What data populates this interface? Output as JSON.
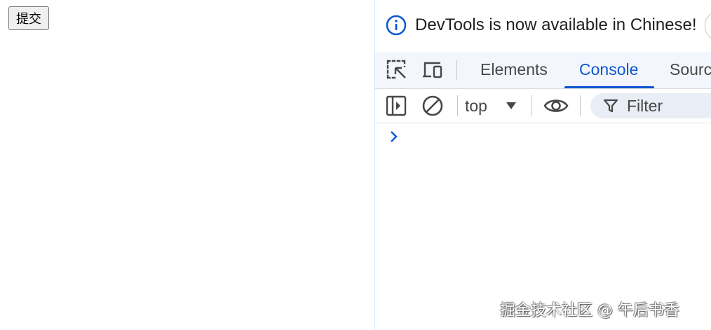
{
  "page": {
    "submit_label": "提交"
  },
  "devtools": {
    "infobar": {
      "message": "DevTools is now available in Chinese!",
      "icon": "info-icon"
    },
    "tabbar": {
      "tool_icons": [
        "inspect-element-icon",
        "device-toolbar-icon"
      ],
      "tabs": [
        {
          "label": "Elements",
          "active": false
        },
        {
          "label": "Console",
          "active": true
        },
        {
          "label": "Sourc",
          "active": false
        }
      ]
    },
    "console_toolbar": {
      "sidebar_icon": "sidebar-toggle-icon",
      "clear_icon": "clear-console-icon",
      "context": "top",
      "live_expression_icon": "eye-icon",
      "filter_placeholder": "Filter"
    },
    "console": {
      "prompt_icon": "chevron-right-icon"
    }
  },
  "watermark": "掘金技术社区 @ 午后书香",
  "colors": {
    "accent": "#0b57d0",
    "tabbar_bg": "#f3f6fc",
    "filter_bg": "#e9eef6",
    "icon": "#474747"
  }
}
